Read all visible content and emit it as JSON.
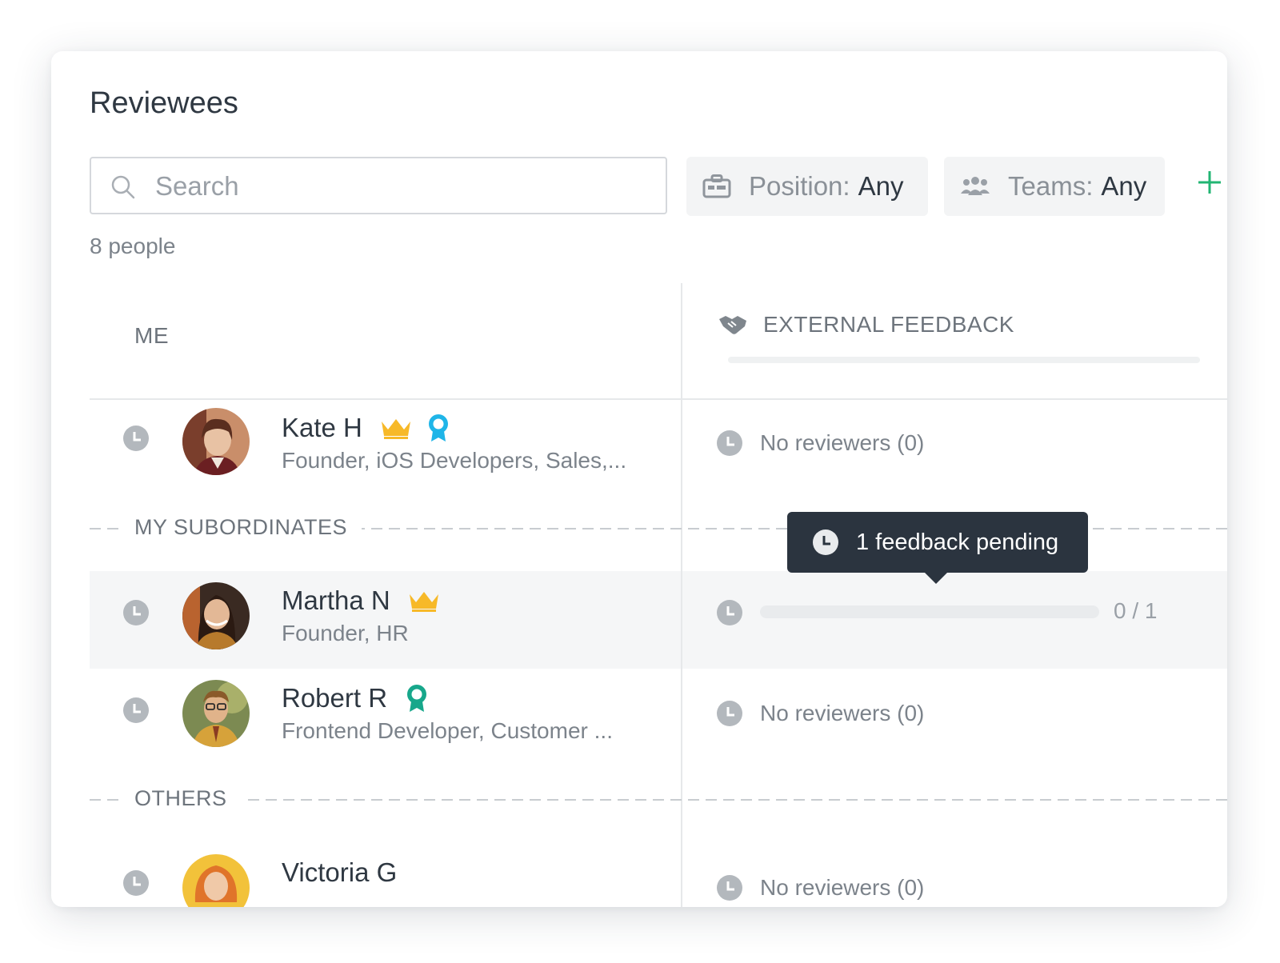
{
  "page": {
    "title": "Reviewees"
  },
  "search": {
    "placeholder": "Search"
  },
  "filters": {
    "position": {
      "label": "Position:",
      "value": "Any"
    },
    "teams": {
      "label": "Teams:",
      "value": "Any"
    },
    "add_symbol": "+"
  },
  "people_count": "8 people",
  "columns": {
    "me": "ME",
    "external_feedback": "EXTERNAL FEEDBACK"
  },
  "sections": {
    "subordinates": "MY SUBORDINATES",
    "others": "OTHERS"
  },
  "rows": [
    {
      "name": "Kate H",
      "subtitle": "Founder, iOS Developers, Sales,...",
      "badges": [
        "crown-icon",
        "award-ribbon-icon"
      ],
      "status": "No reviewers (0)"
    },
    {
      "name": "Martha N",
      "subtitle": "Founder, HR",
      "badges": [
        "crown-icon"
      ],
      "progress": {
        "completed": 0,
        "total": 1,
        "text": "0 / 1"
      }
    },
    {
      "name": "Robert R",
      "subtitle": "Frontend Developer, Customer ...",
      "badges": [
        "award-ribbon-icon"
      ],
      "status": "No reviewers (0)"
    },
    {
      "name": "Victoria G",
      "status": "No reviewers (0)"
    }
  ],
  "tooltip": {
    "text": "1 feedback pending"
  },
  "colors": {
    "crown": "#f7b928",
    "badge_blue": "#1fb5e8",
    "badge_green": "#17a78b",
    "accent_green": "#22b573",
    "tooltip_bg": "#2b343f",
    "clock_gray": "#b3b8bd"
  }
}
